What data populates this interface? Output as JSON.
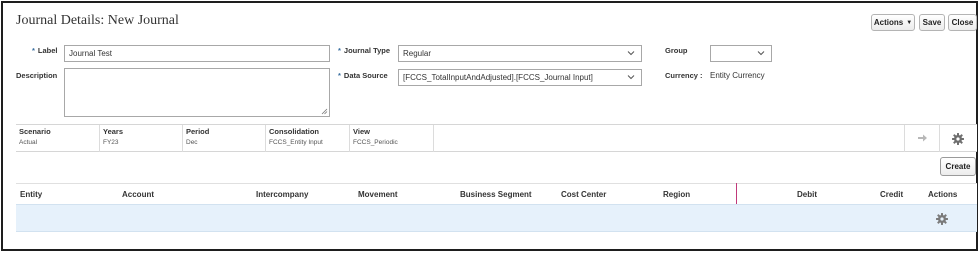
{
  "header": {
    "title": "Journal Details: New Journal"
  },
  "toolbar": {
    "actions_label": "Actions",
    "save_label": "Save",
    "close_label": "Close"
  },
  "form": {
    "label": {
      "label": "Label",
      "value": "Journal Test"
    },
    "description": {
      "label": "Description",
      "value": ""
    },
    "journal_type": {
      "label": "Journal Type",
      "value": "Regular"
    },
    "data_source": {
      "label": "Data Source",
      "value": "[FCCS_TotalInputAndAdjusted].[FCCS_Journal Input]"
    },
    "group": {
      "label": "Group",
      "value": ""
    },
    "currency": {
      "label": "Currency :",
      "value": "Entity Currency"
    }
  },
  "pov": [
    {
      "header": "Scenario",
      "value": "Actual"
    },
    {
      "header": "Years",
      "value": "FY23"
    },
    {
      "header": "Period",
      "value": "Dec"
    },
    {
      "header": "Consolidation",
      "value": "FCCS_Entity Input"
    },
    {
      "header": "View",
      "value": "FCCS_Periodic"
    }
  ],
  "create_label": "Create",
  "table": {
    "columns": [
      "Entity",
      "Account",
      "Intercompany",
      "Movement",
      "Business Segment",
      "Cost Center",
      "Region",
      "Debit",
      "Credit",
      "Actions"
    ]
  },
  "icons": {
    "go": "arrow-right-icon",
    "settings": "gear-icon"
  },
  "colors": {
    "row_highlight": "#e6f1fb",
    "required_marker": "#3a6fa0",
    "column_divider": "#c0397a"
  }
}
